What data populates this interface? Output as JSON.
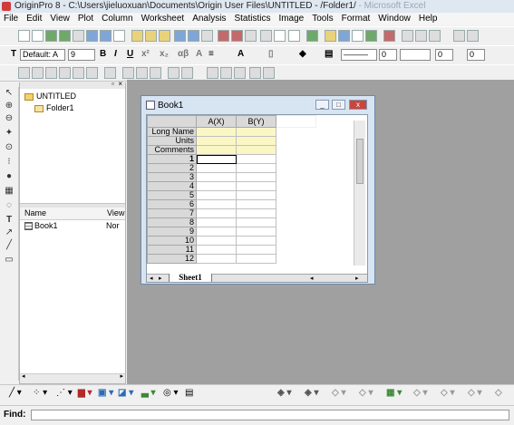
{
  "window": {
    "title_main": "OriginPro 8 - C:\\Users\\jieluoxuan\\Documents\\Origin User Files\\UNTITLED - /Folder1/",
    "title_faded": " - Microsoft Excel"
  },
  "menu": [
    "File",
    "Edit",
    "View",
    "Plot",
    "Column",
    "Worksheet",
    "Analysis",
    "Statistics",
    "Image",
    "Tools",
    "Format",
    "Window",
    "Help"
  ],
  "format_toolbar": {
    "font": "Default: A",
    "size": "9",
    "line_width": "0",
    "fill_value": "0",
    "pattern_value": "0"
  },
  "project_explorer": {
    "root_folder": "UNTITLED",
    "child_folder": "Folder1",
    "columns": [
      "Name",
      "View"
    ],
    "items": [
      {
        "name": "Book1",
        "view": "Nor"
      }
    ]
  },
  "workbook": {
    "title": "Book1",
    "column_headers": [
      "A(X)",
      "B(Y)"
    ],
    "label_rows": [
      "Long Name",
      "Units",
      "Comments"
    ],
    "row_numbers": [
      "1",
      "2",
      "3",
      "4",
      "5",
      "6",
      "7",
      "8",
      "9",
      "10",
      "11",
      "12"
    ],
    "sheet_tab": "Sheet1",
    "btn_min": "_",
    "btn_max": "□",
    "btn_close": "x"
  },
  "findbar": {
    "label": "Find:"
  }
}
